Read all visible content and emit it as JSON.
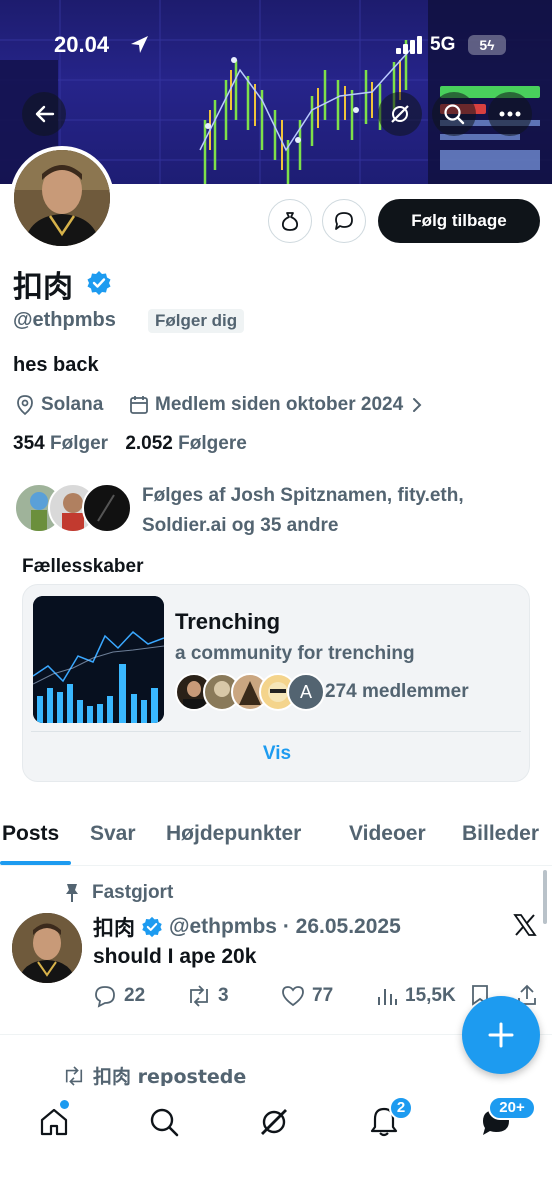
{
  "status_bar": {
    "time": "20.04",
    "network": "5G",
    "battery": "5ϟ"
  },
  "profile": {
    "display_name": "扣肉",
    "handle": "@ethpmbs",
    "follows_you": "Følger dig",
    "bio": "hes back",
    "location": "Solana",
    "joined": "Medlem siden oktober 2024",
    "following_count": "354",
    "following_label": "Følger",
    "followers_count": "2.052",
    "followers_label": "Følgere",
    "followed_by": "Følges af Josh Spitznamen, fity.eth, Soldier.ai og 35 andre",
    "follow_back_label": "Følg tilbage"
  },
  "communities": {
    "title": "Fællesskaber",
    "name": "Trenching",
    "description": "a community for trenching",
    "members": "274 medlemmer",
    "member_initial": "A",
    "view_label": "Vis"
  },
  "tabs": [
    "Posts",
    "Svar",
    "Højdepunkter",
    "Videoer",
    "Billeder"
  ],
  "pinned_post": {
    "pinned_label": "Fastgjort",
    "name": "扣肉",
    "handle_date": "@ethpmbs · 26.05.2025",
    "text": "should I ape 20k",
    "replies": "22",
    "reposts": "3",
    "likes": "77",
    "views": "15,5K"
  },
  "repost_label": "扣肉 repostede",
  "nav": {
    "notifications_badge": "2",
    "messages_badge": "20+"
  },
  "colors": {
    "accent": "#1d9bf0",
    "text": "#0f1419",
    "secondary": "#536471"
  }
}
